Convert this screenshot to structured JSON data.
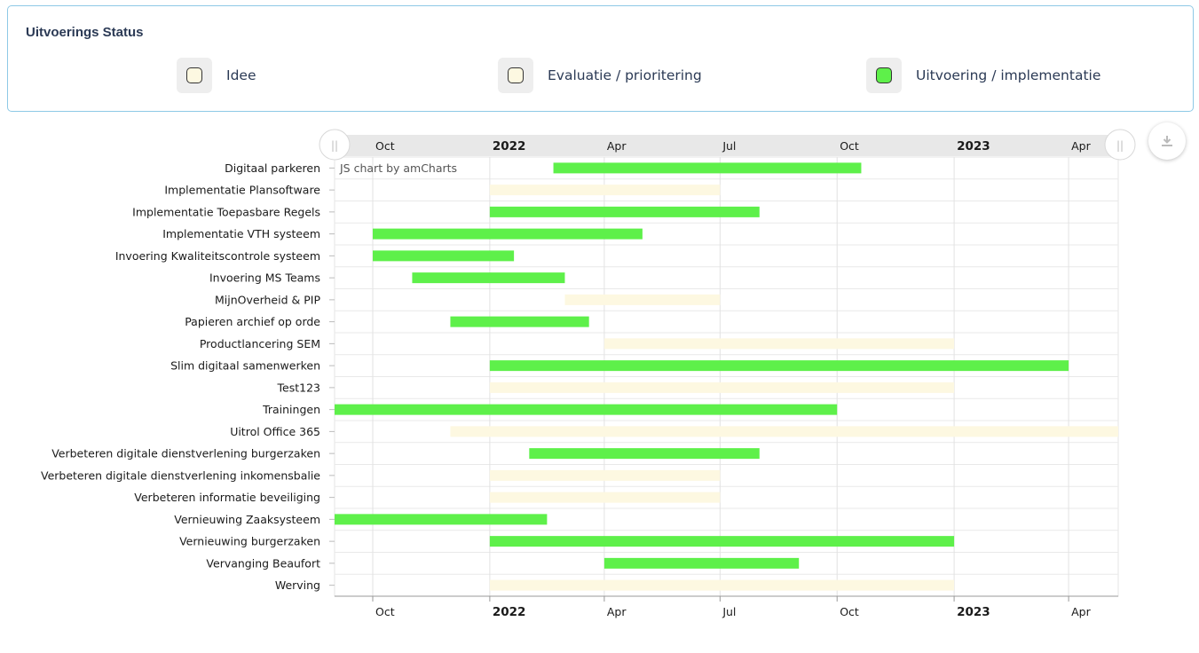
{
  "status": {
    "title": "Uitvoerings Status",
    "items": [
      {
        "label": "Idee",
        "color": "#fdf8e1"
      },
      {
        "label": "Evaluatie / prioritering",
        "color": "#fdf8e1"
      },
      {
        "label": "Uitvoering / implementatie",
        "color": "#5ef04a"
      }
    ]
  },
  "chart": {
    "credit": "JS chart by amCharts",
    "scrollbar_handle_left": "||",
    "scrollbar_handle_right": "||",
    "download_icon": "download-icon"
  },
  "chart_data": {
    "type": "gantt",
    "xlim": [
      "2021-09-01",
      "2023-05-10"
    ],
    "x_ticks": [
      {
        "date": "2021-10-01",
        "label": "Oct",
        "bold": false
      },
      {
        "date": "2022-01-01",
        "label": "2022",
        "bold": true
      },
      {
        "date": "2022-04-01",
        "label": "Apr",
        "bold": false
      },
      {
        "date": "2022-07-01",
        "label": "Jul",
        "bold": false
      },
      {
        "date": "2022-10-01",
        "label": "Oct",
        "bold": false
      },
      {
        "date": "2023-01-01",
        "label": "2023",
        "bold": true
      },
      {
        "date": "2023-04-01",
        "label": "Apr",
        "bold": false
      }
    ],
    "status_colors": {
      "implementatie": "#5ef04a",
      "idee": "#fdf8e1"
    },
    "tasks": [
      {
        "name": "Digitaal parkeren",
        "start": "2022-02-20",
        "end": "2022-10-20",
        "status": "implementatie"
      },
      {
        "name": "Implementatie Plansoftware",
        "start": "2022-01-01",
        "end": "2022-07-01",
        "status": "idee"
      },
      {
        "name": "Implementatie Toepasbare Regels",
        "start": "2022-01-01",
        "end": "2022-08-01",
        "status": "implementatie"
      },
      {
        "name": "Implementatie VTH systeem",
        "start": "2021-10-01",
        "end": "2022-05-01",
        "status": "implementatie"
      },
      {
        "name": "Invoering Kwaliteitscontrole systeem",
        "start": "2021-10-01",
        "end": "2022-01-20",
        "status": "implementatie"
      },
      {
        "name": "Invoering MS Teams",
        "start": "2021-11-01",
        "end": "2022-03-01",
        "status": "implementatie"
      },
      {
        "name": "MijnOverheid & PIP",
        "start": "2022-03-01",
        "end": "2022-07-01",
        "status": "idee"
      },
      {
        "name": "Papieren archief op orde",
        "start": "2021-12-01",
        "end": "2022-03-20",
        "status": "implementatie"
      },
      {
        "name": "Productlancering SEM",
        "start": "2022-04-01",
        "end": "2023-01-01",
        "status": "idee"
      },
      {
        "name": "Slim digitaal samenwerken",
        "start": "2022-01-01",
        "end": "2023-04-01",
        "status": "implementatie"
      },
      {
        "name": "Test123",
        "start": "2022-01-01",
        "end": "2023-01-01",
        "status": "idee"
      },
      {
        "name": "Trainingen",
        "start": "2021-09-01",
        "end": "2022-10-01",
        "status": "implementatie"
      },
      {
        "name": "Uitrol Office 365",
        "start": "2021-12-01",
        "end": "2023-05-10",
        "status": "idee"
      },
      {
        "name": "Verbeteren digitale dienstverlening burgerzaken",
        "start": "2022-02-01",
        "end": "2022-08-01",
        "status": "implementatie"
      },
      {
        "name": "Verbeteren digitale dienstverlening inkomensbalie",
        "start": "2022-01-01",
        "end": "2022-07-01",
        "status": "idee"
      },
      {
        "name": "Verbeteren informatie beveiliging",
        "start": "2022-01-01",
        "end": "2022-07-01",
        "status": "idee"
      },
      {
        "name": "Vernieuwing Zaaksysteem",
        "start": "2021-09-01",
        "end": "2022-02-15",
        "status": "implementatie"
      },
      {
        "name": "Vernieuwing burgerzaken",
        "start": "2022-01-01",
        "end": "2023-01-01",
        "status": "implementatie"
      },
      {
        "name": "Vervanging Beaufort",
        "start": "2022-04-01",
        "end": "2022-09-01",
        "status": "implementatie"
      },
      {
        "name": "Werving",
        "start": "2022-01-01",
        "end": "2023-01-01",
        "status": "idee"
      }
    ]
  }
}
